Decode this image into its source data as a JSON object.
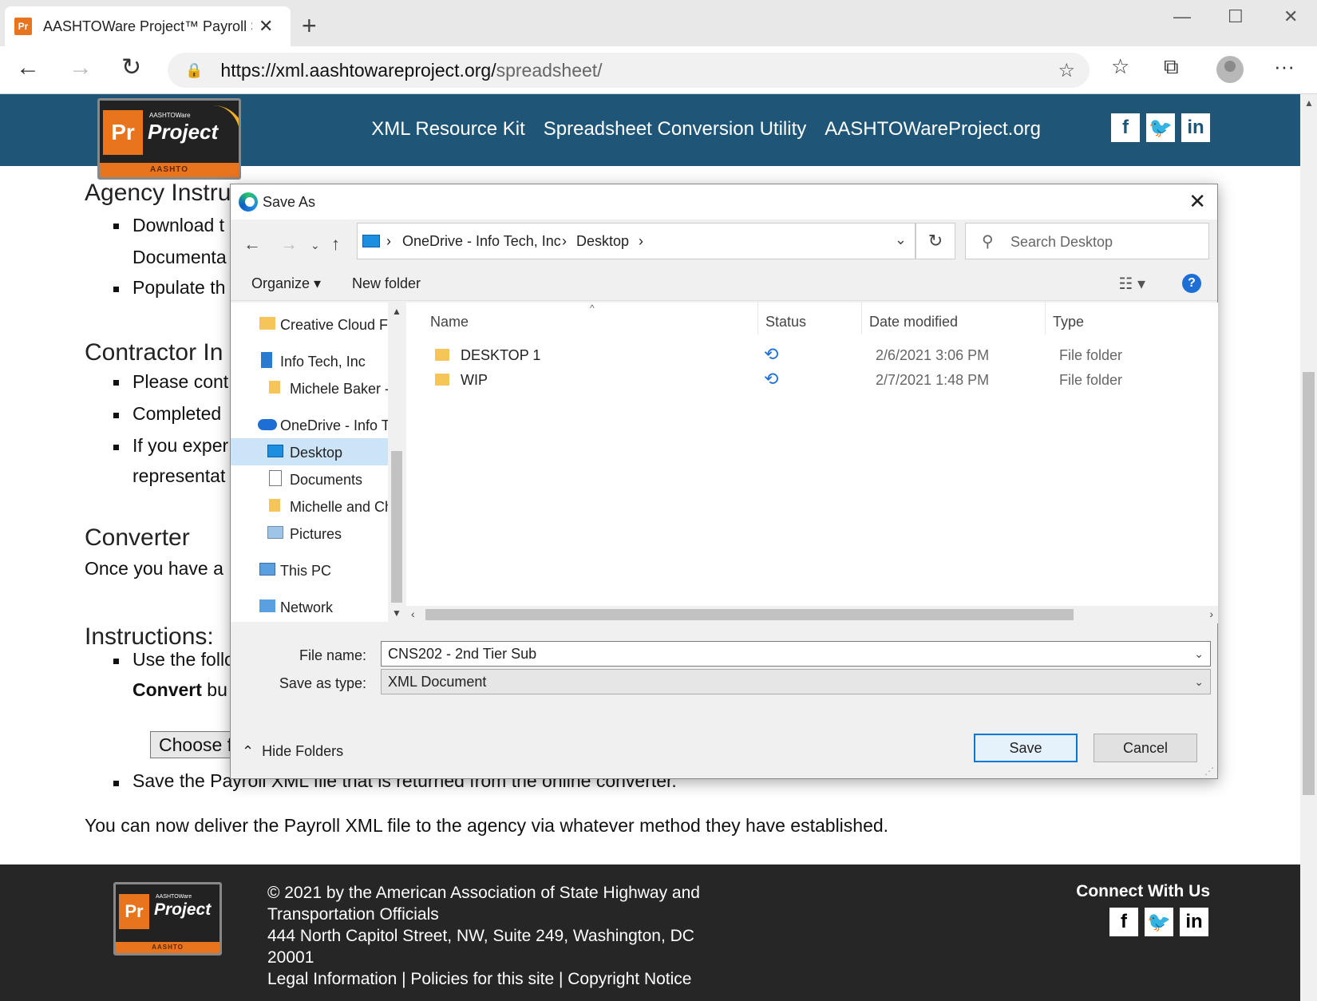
{
  "browser": {
    "tab_title": "AASHTOWare Project™ Payroll Sp",
    "tab_favicon": "Pr",
    "url_host": "https://xml.aashtowareproject.org/",
    "url_path": "spreadsheet/"
  },
  "site": {
    "logo": {
      "badge": "Pr",
      "small_text": "AASHTOWare",
      "name": "Project",
      "bar": "AASHTO"
    },
    "nav": [
      "XML Resource Kit",
      "Spreadsheet Conversion Utility",
      "AASHTOWareProject.org"
    ],
    "social": [
      "f",
      "t",
      "in"
    ]
  },
  "content": {
    "agency_heading": "Agency Instru",
    "agency_items": [
      "Download t",
      "Documenta",
      "Populate th"
    ],
    "contractor_heading": "Contractor In",
    "contractor_items": [
      "Please cont",
      "Completed",
      "If you exper",
      "representat"
    ],
    "converter_heading": "Converter",
    "converter_text": "Once you have a",
    "instructions_heading": "Instructions:",
    "instructions_item": "Use the follo",
    "convert_text": "Convert",
    "convert_suffix": " bu",
    "choose_button": "Choose f",
    "save_item": "Save the Payroll XML file that is returned from the online converter.",
    "deliver_text": "You can now deliver the Payroll XML file to the agency via whatever method they have established."
  },
  "footer": {
    "copyright_1": "© 2021 by the American Association of State Highway and",
    "copyright_2": "Transportation Officials",
    "address_1": "444 North Capitol Street, NW, Suite 249, Washington, DC",
    "address_2": "20001",
    "links": "Legal Information | Policies for this site | Copyright Notice",
    "connect": "Connect With Us"
  },
  "dialog": {
    "title": "Save As",
    "breadcrumbs": [
      "OneDrive - Info Tech, Inc",
      "Desktop"
    ],
    "search_placeholder": "Search Desktop",
    "organize": "Organize ▾",
    "new_folder": "New folder",
    "nav_items": [
      "Creative Cloud Files",
      "Info Tech, Inc",
      "Michele Baker - T",
      "OneDrive - Info Te",
      "Desktop",
      "Documents",
      "Michelle and Chr",
      "Pictures",
      "This PC",
      "Network"
    ],
    "columns": [
      "Name",
      "Status",
      "Date modified",
      "Type"
    ],
    "files": [
      {
        "name": "DESKTOP 1",
        "date": "2/6/2021 3:06 PM",
        "type": "File folder"
      },
      {
        "name": "WIP",
        "date": "2/7/2021 1:48 PM",
        "type": "File folder"
      }
    ],
    "file_name_label": "File name:",
    "file_name_value": "CNS202 - 2nd Tier Sub",
    "save_type_label": "Save as type:",
    "save_type_value": "XML Document",
    "hide_folders": "Hide Folders",
    "save_button": "Save",
    "cancel_button": "Cancel"
  }
}
